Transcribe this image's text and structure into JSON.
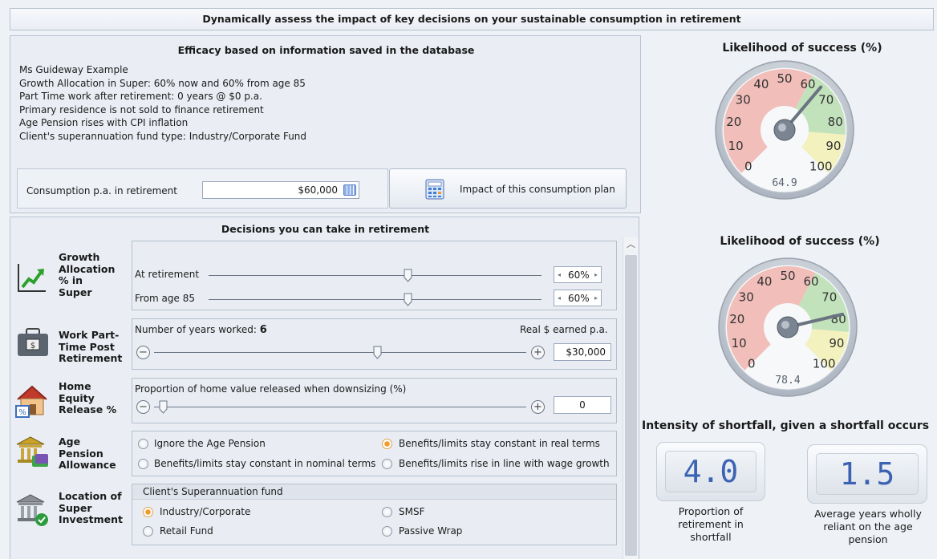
{
  "header": {
    "title": "Dynamically assess the impact of key decisions on your sustainable consumption in retirement"
  },
  "efficacy": {
    "title": "Efficacy based on information saved in the database",
    "lines": [
      "Ms Guideway Example",
      "Growth Allocation in Super: 60% now and 60% from age 85",
      "Part Time work after retirement: 0 years @ $0 p.a.",
      "Primary residence is not sold to finance retirement",
      "Age Pension rises with CPI inflation",
      "Client's superannuation fund type: Industry/Corporate Fund"
    ],
    "consumption_label": "Consumption p.a. in retirement",
    "consumption_value": "$60,000",
    "impact_button": "Impact of this consumption plan"
  },
  "gauge1": {
    "title": "Likelihood of success (%)",
    "value": 64.9,
    "readout": "64.9",
    "ticks": [
      "0",
      "10",
      "20",
      "30",
      "40",
      "50",
      "60",
      "70",
      "80",
      "90",
      "100"
    ]
  },
  "gauge2": {
    "title": "Likelihood of success (%)",
    "value": 78.4,
    "readout": "78.4",
    "ticks": [
      "0",
      "10",
      "20",
      "30",
      "40",
      "50",
      "60",
      "70",
      "80",
      "90",
      "100"
    ]
  },
  "decisions": {
    "title": "Decisions you can take in retirement",
    "growth": {
      "label": "Growth Allocation % in Super",
      "at_retirement_label": "At retirement",
      "at_retirement_value": "60%",
      "at_retirement_pct": 0.6,
      "from85_label": "From age 85",
      "from85_value": "60%",
      "from85_pct": 0.6
    },
    "work": {
      "label": "Work Part-Time Post Retirement",
      "years_label": "Number of years worked:",
      "years_value": "6",
      "earned_label": "Real $ earned p.a.",
      "earned_value": "$30,000",
      "slider_pct": 0.6
    },
    "home": {
      "label": "Home Equity Release %",
      "prop_label": "Proportion of home value released when downsizing (%)",
      "value": "0",
      "slider_pct": 0
    },
    "pension": {
      "label": "Age Pension Allowance",
      "options": [
        "Ignore the Age Pension",
        "Benefits/limits stay constant in real terms",
        "Benefits/limits stay constant in nominal terms",
        "Benefits/limits rise in line with wage growth"
      ],
      "selected": "Benefits/limits stay constant in real terms"
    },
    "location": {
      "label": "Location of Super Investment",
      "group_label": "Client's Superannuation fund",
      "options": [
        "Industry/Corporate",
        "SMSF",
        "Retail Fund",
        "Passive Wrap"
      ],
      "selected": "Industry/Corporate"
    }
  },
  "shortfall": {
    "title": "Intensity of shortfall, given a shortfall occurs",
    "proportion_value": "4.0",
    "proportion_caption": "Proportion of retirement in shortfall",
    "years_value": "1.5",
    "years_caption": "Average years wholly reliant on the age pension"
  },
  "colors": {
    "accent_orange": "#f39a2b",
    "lcd_blue": "#3c63b3",
    "gauge_red": "#f0b4ae",
    "gauge_green": "#b8deb0",
    "gauge_yellow": "#f2f0b2"
  }
}
